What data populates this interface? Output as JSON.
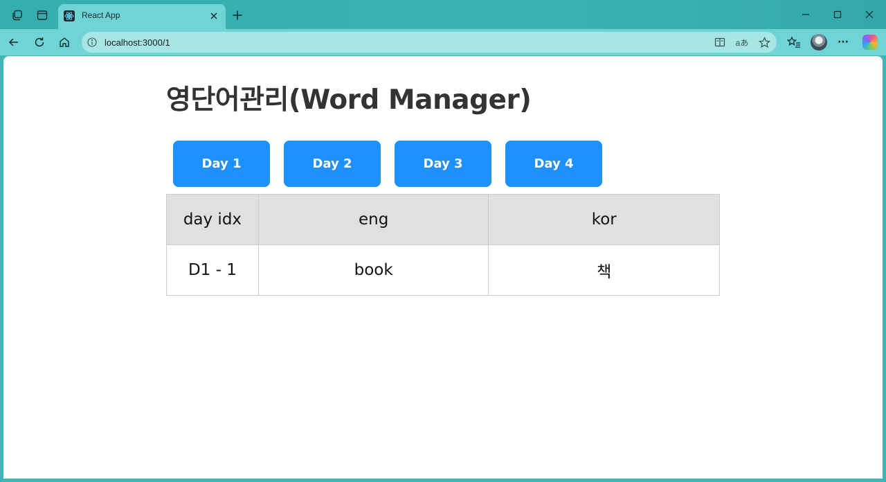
{
  "browser": {
    "tab_title": "React App",
    "url": "localhost:3000/1",
    "icons": [
      "workspaces-icon",
      "tab-actions-icon",
      "react-favicon-icon",
      "close-icon",
      "plus-icon",
      "minimize-icon",
      "maximize-icon",
      "window-close-icon",
      "back-icon",
      "refresh-icon",
      "home-icon",
      "info-icon",
      "immersive-reader-icon",
      "read-aloud-icon",
      "star-icon",
      "favorites-icon",
      "more-icon",
      "copilot-icon"
    ],
    "read_aloud_label": "aあ",
    "more_label": "···"
  },
  "page": {
    "title": "영단어관리(Word Manager)",
    "day_buttons": [
      "Day 1",
      "Day 2",
      "Day 3",
      "Day 4"
    ],
    "button_color": "#1e90ff",
    "table": {
      "headers": [
        "day idx",
        "eng",
        "kor"
      ],
      "rows": [
        [
          "D1 - 1",
          "book",
          "책"
        ]
      ]
    }
  }
}
